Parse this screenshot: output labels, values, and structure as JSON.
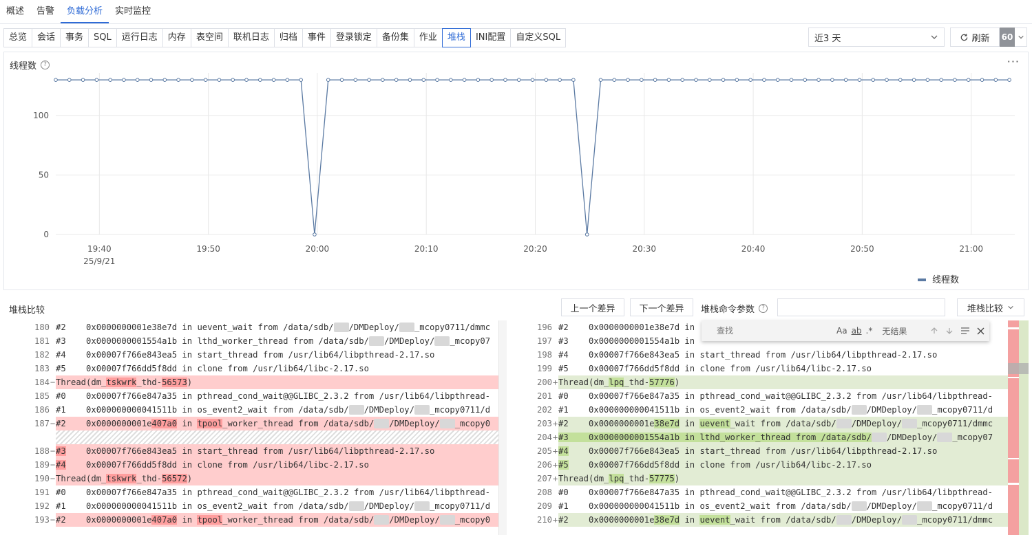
{
  "top_tabs": [
    {
      "label": "概述",
      "active": false
    },
    {
      "label": "告警",
      "active": false
    },
    {
      "label": "负载分析",
      "active": true
    },
    {
      "label": "实时监控",
      "active": false
    }
  ],
  "sub_tabs": [
    {
      "label": "总览",
      "active": false
    },
    {
      "label": "会话",
      "active": false
    },
    {
      "label": "事务",
      "active": false
    },
    {
      "label": "SQL",
      "active": false
    },
    {
      "label": "运行日志",
      "active": false
    },
    {
      "label": "内存",
      "active": false
    },
    {
      "label": "表空间",
      "active": false
    },
    {
      "label": "联机日志",
      "active": false
    },
    {
      "label": "归档",
      "active": false
    },
    {
      "label": "事件",
      "active": false
    },
    {
      "label": "登录锁定",
      "active": false
    },
    {
      "label": "备份集",
      "active": false
    },
    {
      "label": "作业",
      "active": false
    },
    {
      "label": "堆栈",
      "active": true
    },
    {
      "label": "INI配置",
      "active": false
    },
    {
      "label": "自定义SQL",
      "active": false
    }
  ],
  "toolbar": {
    "range": "近3 天",
    "refresh_label": "刷新",
    "interval": "60"
  },
  "chart": {
    "title": "线程数",
    "legend": "线程数",
    "more": "···"
  },
  "chart_data": {
    "type": "line",
    "title": "线程数",
    "x_ticks": [
      {
        "label": "19:40",
        "sub": "25/9/21",
        "min": 0
      },
      {
        "label": "19:50",
        "sub": "",
        "min": 10
      },
      {
        "label": "20:00",
        "sub": "",
        "min": 20
      },
      {
        "label": "20:10",
        "sub": "",
        "min": 30
      },
      {
        "label": "20:20",
        "sub": "",
        "min": 40
      },
      {
        "label": "20:30",
        "sub": "",
        "min": 50
      },
      {
        "label": "20:40",
        "sub": "",
        "min": 60
      },
      {
        "label": "20:50",
        "sub": "",
        "min": 70
      },
      {
        "label": "21:00",
        "sub": "",
        "min": 80
      }
    ],
    "y_ticks": [
      0,
      50,
      100
    ],
    "ylim": [
      0,
      133
    ],
    "xlim": [
      -4,
      84
    ],
    "series": [
      {
        "name": "线程数",
        "color": "#5b7aa3",
        "x_start": -4,
        "x_step": 1.25,
        "values": [
          130,
          130,
          130,
          130,
          130,
          130,
          130,
          130,
          130,
          130,
          130,
          130,
          130,
          130,
          130,
          130,
          130,
          130,
          130,
          0,
          130,
          130,
          130,
          130,
          130,
          130,
          130,
          130,
          130,
          130,
          130,
          130,
          130,
          130,
          130,
          130,
          130,
          130,
          130,
          0,
          130,
          130,
          130,
          130,
          130,
          130,
          130,
          130,
          130,
          130,
          130,
          130,
          130,
          130,
          130,
          130,
          130,
          130,
          130,
          130,
          130,
          130,
          130,
          130,
          130,
          130,
          130,
          130,
          130,
          130,
          130
        ]
      }
    ],
    "legend_position": "bottom-right"
  },
  "compare": {
    "title": "堆栈比较",
    "prev_label": "上一个差异",
    "next_label": "下一个差异",
    "param_label": "堆栈命令参数",
    "mode_label": "堆栈比较"
  },
  "find": {
    "placeholder": "查找",
    "case": "Aa",
    "word": "ab",
    "regex": ".*",
    "result": "无结果"
  },
  "left_lines": [
    {
      "num": "180",
      "type": "",
      "mark": "",
      "segs": [
        {
          "t": "#2    0x0000000001e38e7d in uevent_wait from /data/sdb/"
        },
        {
          "t": "xxx",
          "b": 1
        },
        {
          "t": "/DMDeploy/"
        },
        {
          "t": "xxx",
          "b": 1
        },
        {
          "t": "_mcopy0711/dmmc"
        }
      ]
    },
    {
      "num": "181",
      "type": "",
      "mark": "",
      "segs": [
        {
          "t": "#3    0x0000000001554a1b in lthd_worker_thread from /data/sdb/"
        },
        {
          "t": "xxx",
          "b": 1
        },
        {
          "t": "/DMDeploy/"
        },
        {
          "t": "xxx",
          "b": 1
        },
        {
          "t": "_mcopy07"
        }
      ]
    },
    {
      "num": "182",
      "type": "",
      "mark": "",
      "segs": [
        {
          "t": "#4    0x00007f766e843ea5 in start_thread from /usr/lib64/libpthread-2.17.so"
        }
      ]
    },
    {
      "num": "183",
      "type": "",
      "mark": "",
      "segs": [
        {
          "t": "#5    0x00007f766dd5f8dd in clone from /usr/lib64/libc-2.17.so"
        }
      ]
    },
    {
      "num": "184",
      "type": "del",
      "mark": "−",
      "segs": [
        {
          "t": "Thread(dm_"
        },
        {
          "t": "tskwrk",
          "h": 1
        },
        {
          "t": "_thd-"
        },
        {
          "t": "56573",
          "h": 1
        },
        {
          "t": ")"
        }
      ]
    },
    {
      "num": "185",
      "type": "",
      "mark": "",
      "segs": [
        {
          "t": "#0    0x00007f766e847a35 in pthread_cond_wait@@GLIBC_2.3.2 from /usr/lib64/libpthread-"
        }
      ]
    },
    {
      "num": "186",
      "type": "",
      "mark": "",
      "segs": [
        {
          "t": "#1    0x000000000041511b in os_event2_wait from /data/sdb/"
        },
        {
          "t": "xxx",
          "b": 1
        },
        {
          "t": "/DMDeploy/"
        },
        {
          "t": "xxx",
          "b": 1
        },
        {
          "t": "_mcopy0711/d"
        }
      ]
    },
    {
      "num": "187",
      "type": "del",
      "mark": "−",
      "segs": [
        {
          "t": "#2    0x0000000001e"
        },
        {
          "t": "407a0",
          "h": 1
        },
        {
          "t": " in "
        },
        {
          "t": "tpool",
          "h": 1
        },
        {
          "t": "_worker_thread from /data/sdb/"
        },
        {
          "t": "xxx",
          "b": 1
        },
        {
          "t": "/DMDeploy/"
        },
        {
          "t": "xxx",
          "b": 1
        },
        {
          "t": "_mcopy0"
        }
      ]
    },
    {
      "num": "",
      "type": "hatch",
      "mark": "",
      "segs": []
    },
    {
      "num": "188",
      "type": "del",
      "mark": "−",
      "segs": [
        {
          "t": "#3",
          "h": 1
        },
        {
          "t": "    0x00007f766e843ea5 in start_thread from /usr/lib64/libpthread-2.17.so"
        }
      ]
    },
    {
      "num": "189",
      "type": "del",
      "mark": "−",
      "segs": [
        {
          "t": "#4",
          "h": 1
        },
        {
          "t": "    0x00007f766dd5f8dd in clone from /usr/lib64/libc-2.17.so"
        }
      ]
    },
    {
      "num": "190",
      "type": "del",
      "mark": "−",
      "segs": [
        {
          "t": "Thread(dm_"
        },
        {
          "t": "tskwrk",
          "h": 1
        },
        {
          "t": "_thd-"
        },
        {
          "t": "56572",
          "h": 1
        },
        {
          "t": ")"
        }
      ]
    },
    {
      "num": "191",
      "type": "",
      "mark": "",
      "segs": [
        {
          "t": "#0    0x00007f766e847a35 in pthread_cond_wait@@GLIBC_2.3.2 from /usr/lib64/libpthread-"
        }
      ]
    },
    {
      "num": "192",
      "type": "",
      "mark": "",
      "segs": [
        {
          "t": "#1    0x000000000041511b in os_event2_wait from /data/sdb/"
        },
        {
          "t": "xxx",
          "b": 1
        },
        {
          "t": "/DMDeploy/"
        },
        {
          "t": "xxx",
          "b": 1
        },
        {
          "t": "_mcopy0711/d"
        }
      ]
    },
    {
      "num": "193",
      "type": "del",
      "mark": "−",
      "segs": [
        {
          "t": "#2    0x0000000001e"
        },
        {
          "t": "407a0",
          "h": 1
        },
        {
          "t": " in "
        },
        {
          "t": "tpool",
          "h": 1
        },
        {
          "t": "_worker_thread from /data/sdb/"
        },
        {
          "t": "xxx",
          "b": 1
        },
        {
          "t": "/DMDeploy/"
        },
        {
          "t": "xxx",
          "b": 1
        },
        {
          "t": "_mcopy0"
        }
      ]
    }
  ],
  "right_lines": [
    {
      "num": "196",
      "type": "",
      "mark": "",
      "segs": [
        {
          "t": "#2    0x0000000001e38e7d in "
        }
      ]
    },
    {
      "num": "197",
      "type": "",
      "mark": "",
      "segs": [
        {
          "t": "#3    0x0000000001554a1b in "
        }
      ]
    },
    {
      "num": "198",
      "type": "",
      "mark": "",
      "segs": [
        {
          "t": "#4    0x00007f766e843ea5 in start_thread from /usr/lib64/libpthread-2.17.so"
        }
      ]
    },
    {
      "num": "199",
      "type": "",
      "mark": "",
      "segs": [
        {
          "t": "#5    0x00007f766dd5f8dd in clone from /usr/lib64/libc-2.17.so"
        }
      ]
    },
    {
      "num": "200",
      "type": "add",
      "mark": "+",
      "segs": [
        {
          "t": "Thread(dm_"
        },
        {
          "t": "lpq",
          "h": 1
        },
        {
          "t": "_thd-"
        },
        {
          "t": "57776",
          "h": 1
        },
        {
          "t": ")"
        }
      ]
    },
    {
      "num": "201",
      "type": "",
      "mark": "",
      "segs": [
        {
          "t": "#0    0x00007f766e847a35 in pthread_cond_wait@@GLIBC_2.3.2 from /usr/lib64/libpthread-"
        }
      ]
    },
    {
      "num": "202",
      "type": "",
      "mark": "",
      "segs": [
        {
          "t": "#1    0x000000000041511b in os_event2_wait from /data/sdb/"
        },
        {
          "t": "xxx",
          "b": 1
        },
        {
          "t": "/DMDeploy/"
        },
        {
          "t": "xxx",
          "b": 1
        },
        {
          "t": "_mcopy0711/d"
        }
      ]
    },
    {
      "num": "203",
      "type": "add",
      "mark": "+",
      "segs": [
        {
          "t": "#2    0x0000000001e"
        },
        {
          "t": "38e7d",
          "h": 1
        },
        {
          "t": " in "
        },
        {
          "t": "uevent",
          "h": 1
        },
        {
          "t": "_wait from /data/sdb/"
        },
        {
          "t": "xxx",
          "b": 1
        },
        {
          "t": "/DMDeploy/"
        },
        {
          "t": "xxx",
          "b": 1
        },
        {
          "t": "_mcopy0711/dmmc"
        }
      ]
    },
    {
      "num": "204",
      "type": "add",
      "mark": "+",
      "segs": [
        {
          "t": "#3    0x0000000001554a1b in lthd_worker_thread from /data/sdb/",
          "h": 1
        },
        {
          "t": "xxx",
          "b": 1
        },
        {
          "t": "/DMDeploy/"
        },
        {
          "t": "xxx",
          "b": 1
        },
        {
          "t": "_mcopy07"
        }
      ]
    },
    {
      "num": "205",
      "type": "add",
      "mark": "+",
      "segs": [
        {
          "t": "#4",
          "h": 1
        },
        {
          "t": "    0x00007f766e843ea5 in start_thread from /usr/lib64/libpthread-2.17.so"
        }
      ]
    },
    {
      "num": "206",
      "type": "add",
      "mark": "+",
      "segs": [
        {
          "t": "#5",
          "h": 1
        },
        {
          "t": "    0x00007f766dd5f8dd in clone from /usr/lib64/libc-2.17.so"
        }
      ]
    },
    {
      "num": "207",
      "type": "add",
      "mark": "+",
      "segs": [
        {
          "t": "Thread(dm_"
        },
        {
          "t": "lpq",
          "h": 1
        },
        {
          "t": "_thd-"
        },
        {
          "t": "57775",
          "h": 1
        },
        {
          "t": ")"
        }
      ]
    },
    {
      "num": "208",
      "type": "",
      "mark": "",
      "segs": [
        {
          "t": "#0    0x00007f766e847a35 in pthread_cond_wait@@GLIBC_2.3.2 from /usr/lib64/libpthread-"
        }
      ]
    },
    {
      "num": "209",
      "type": "",
      "mark": "",
      "segs": [
        {
          "t": "#1    0x000000000041511b in os_event2_wait from /data/sdb/"
        },
        {
          "t": "xxx",
          "b": 1
        },
        {
          "t": "/DMDeploy/"
        },
        {
          "t": "xxx",
          "b": 1
        },
        {
          "t": "_mcopy0711/d"
        }
      ]
    },
    {
      "num": "210",
      "type": "add",
      "mark": "+",
      "segs": [
        {
          "t": "#2    0x0000000001e"
        },
        {
          "t": "38e7d",
          "h": 1
        },
        {
          "t": " in "
        },
        {
          "t": "uevent",
          "h": 1
        },
        {
          "t": "_wait from /data/sdb/"
        },
        {
          "t": "xxx",
          "b": 1
        },
        {
          "t": "/DMDeploy/"
        },
        {
          "t": "xxx",
          "b": 1
        },
        {
          "t": "_mcopy0711/dmmc"
        }
      ]
    }
  ]
}
